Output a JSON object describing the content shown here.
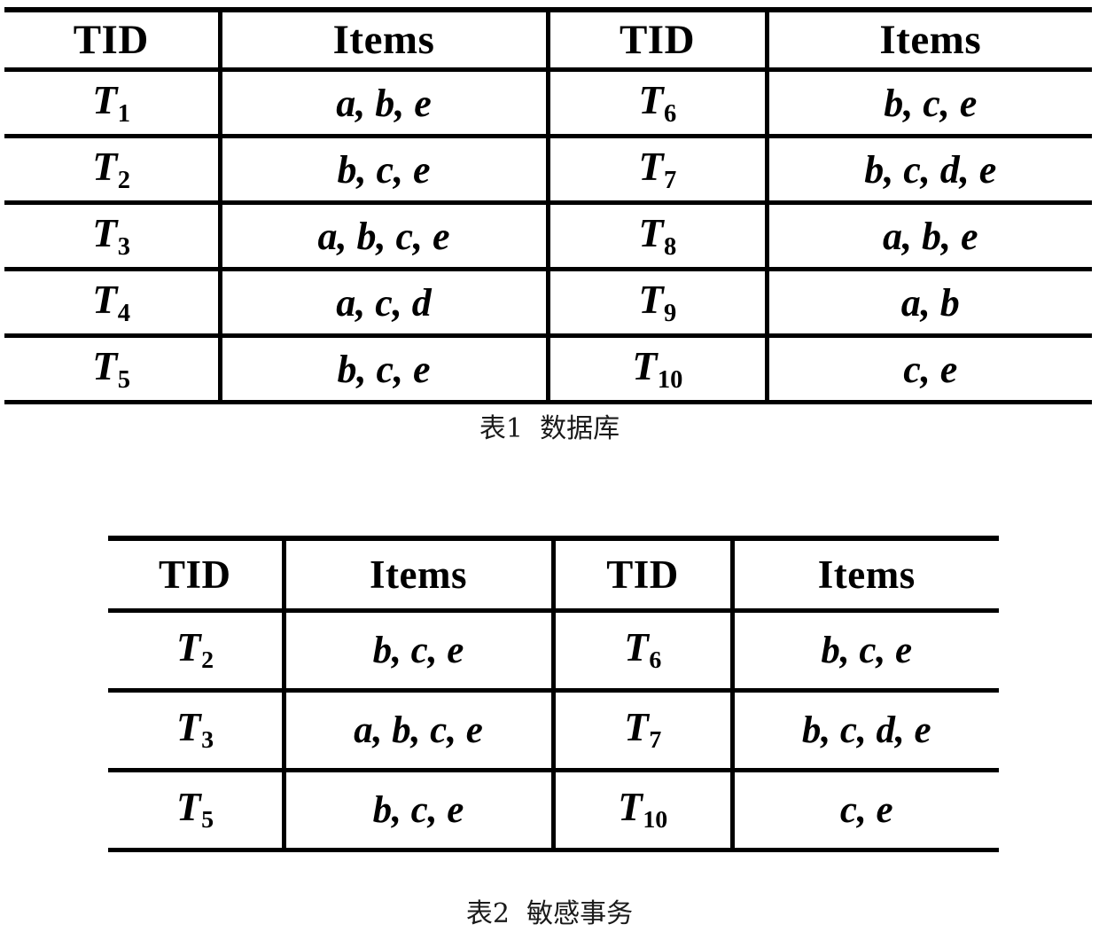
{
  "tables": [
    {
      "id": "database-table",
      "caption": "表1  数据库",
      "headers": [
        "TID",
        "Items",
        "TID",
        "Items"
      ],
      "rows": [
        {
          "tid_left": "T",
          "sub_left": "1",
          "items_left": "a, b, e",
          "tid_right": "T",
          "sub_right": "6",
          "items_right": "b, c, e"
        },
        {
          "tid_left": "T",
          "sub_left": "2",
          "items_left": "b, c, e",
          "tid_right": "T",
          "sub_right": "7",
          "items_right": "b, c, d, e"
        },
        {
          "tid_left": "T",
          "sub_left": "3",
          "items_left": "a, b, c, e",
          "tid_right": "T",
          "sub_right": "8",
          "items_right": "a, b, e"
        },
        {
          "tid_left": "T",
          "sub_left": "4",
          "items_left": "a, c, d",
          "tid_right": "T",
          "sub_right": "9",
          "items_right": "a, b"
        },
        {
          "tid_left": "T",
          "sub_left": "5",
          "items_left": "b, c, e",
          "tid_right": "T",
          "sub_right": "10",
          "items_right": "c, e"
        }
      ]
    },
    {
      "id": "sensitive-transactions-table",
      "caption": "表2  敏感事务",
      "headers": [
        "TID",
        "Items",
        "TID",
        "Items"
      ],
      "rows": [
        {
          "tid_left": "T",
          "sub_left": "2",
          "items_left": "b, c, e",
          "tid_right": "T",
          "sub_right": "6",
          "items_right": "b, c, e"
        },
        {
          "tid_left": "T",
          "sub_left": "3",
          "items_left": "a, b, c, e",
          "tid_right": "T",
          "sub_right": "7",
          "items_right": "b, c, d, e"
        },
        {
          "tid_left": "T",
          "sub_left": "5",
          "items_left": "b, c, e",
          "tid_right": "T",
          "sub_right": "10",
          "items_right": "c, e"
        }
      ]
    }
  ],
  "colors": {
    "rule": "#000000",
    "text": "#000000",
    "background": "#ffffff",
    "caption_text": "#1a1a1a"
  }
}
